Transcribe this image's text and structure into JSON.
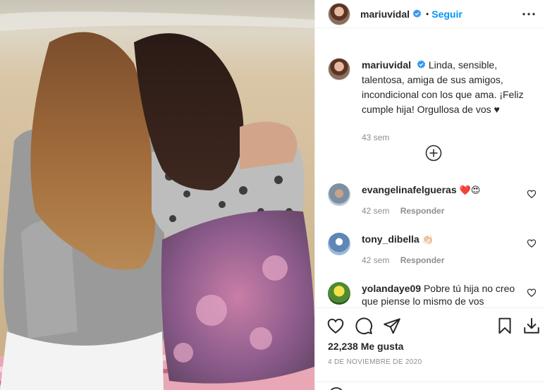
{
  "post": {
    "username": "mariuvidal",
    "follow_label": "Seguir",
    "separator": "•",
    "caption": "Linda, sensible, talentosa, amiga de sus amigos, incondicional con los que ama. ¡Feliz cumple hija! Orgullosa de vos ♥",
    "caption_time": "43 sem",
    "likes": "22,238 Me gusta",
    "date": "4 DE NOVIEMBRE DE 2020"
  },
  "comments": [
    {
      "username": "evangelinafelgueras",
      "text": "",
      "emoji": "❤️😍",
      "time": "42 sem",
      "reply": "Responder"
    },
    {
      "username": "tony_dibella",
      "text": "",
      "emoji": "👏🏻",
      "time": "42 sem",
      "reply": "Responder"
    },
    {
      "username": "yolandaye09",
      "text": "Pobre tú hija no creo que piense lo mismo de vos",
      "emoji": "",
      "time": "",
      "reply": ""
    }
  ],
  "icons": {
    "verified": "verified-badge-icon",
    "more": "more-options-icon",
    "load_more": "plus-circle-icon",
    "like": "heart-icon",
    "comment": "comment-icon",
    "share": "paper-plane-icon",
    "save": "bookmark-icon",
    "download": "download-icon"
  },
  "colors": {
    "accent": "#0095f6",
    "verified": "#3897f0",
    "muted": "#8e8e8e",
    "text": "#262626"
  }
}
